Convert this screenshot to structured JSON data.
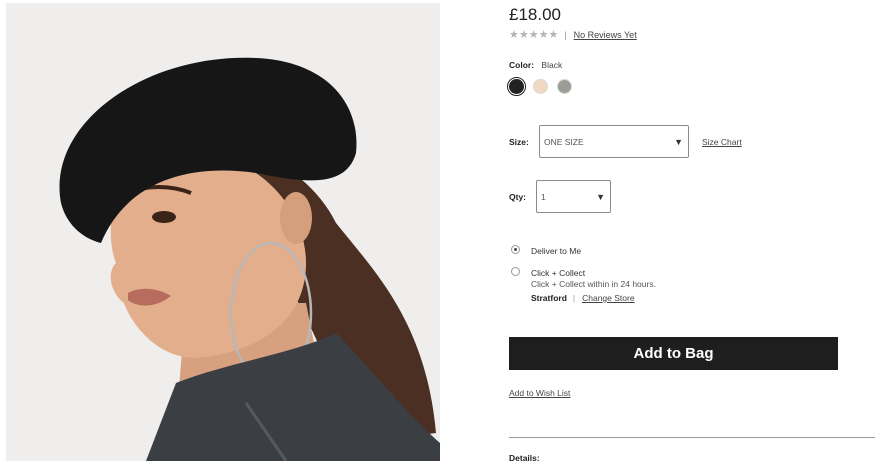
{
  "product": {
    "price": "£18.00",
    "stars": "★★★★★",
    "star_rating": 0,
    "reviews_link": "No Reviews Yet"
  },
  "color": {
    "label": "Color:",
    "selected": "Black",
    "swatches": [
      {
        "name": "Black",
        "hex": "#222222"
      },
      {
        "name": "Cream",
        "hex": "#f0d9c0"
      },
      {
        "name": "Grey",
        "hex": "#9a9d96"
      }
    ]
  },
  "size": {
    "label": "Size:",
    "selected": "ONE SIZE",
    "chart_link": "Size Chart"
  },
  "qty": {
    "label": "Qty:",
    "selected": "1"
  },
  "delivery": {
    "option_deliver": "Deliver to Me",
    "option_collect": "Click + Collect",
    "collect_note": "Click + Collect within in 24 hours.",
    "store_name": "Stratford",
    "change_store": "Change Store",
    "selected": "Deliver to Me"
  },
  "actions": {
    "add_to_bag": "Add to Bag",
    "wish_list": "Add to Wish List"
  },
  "sections": {
    "details": "Details:"
  },
  "colors": {
    "button_bg": "#1e1e1e",
    "star_gray": "#b4b4b4"
  }
}
